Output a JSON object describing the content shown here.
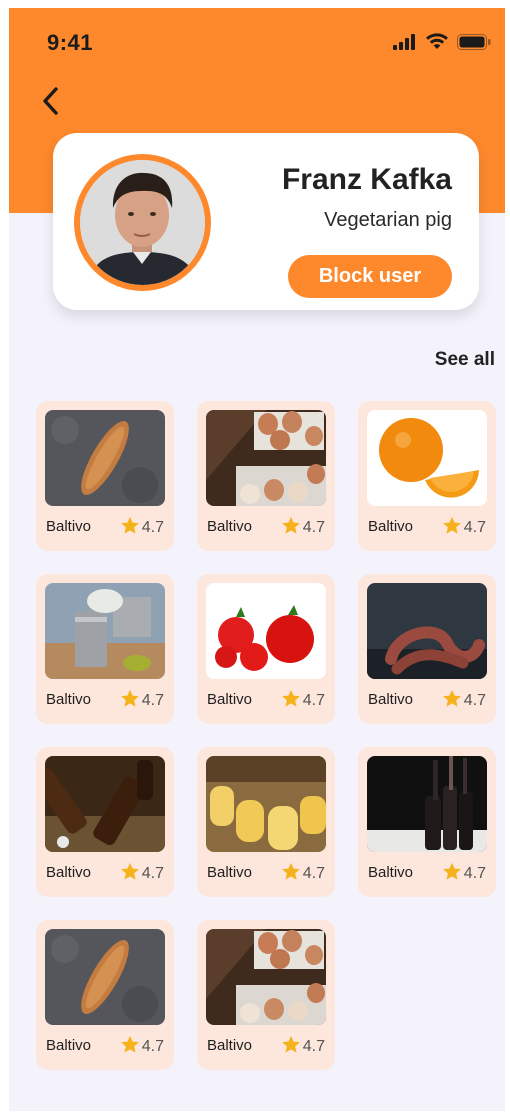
{
  "status_bar": {
    "time": "9:41",
    "icons": [
      "signal-icon",
      "wifi-icon",
      "battery-icon"
    ]
  },
  "colors": {
    "accent": "#fe892d",
    "card_bg": "#fde6dc",
    "page_bg": "#f4f3fb",
    "star": "#f6b21b"
  },
  "header": {
    "back_icon": "chevron-left-icon"
  },
  "profile": {
    "name": "Franz Kafka",
    "subtitle": "Vegetarian pig",
    "block_button_label": "Block user"
  },
  "products_section": {
    "see_all_label": "See all"
  },
  "products": [
    {
      "name": "Baltivo",
      "rating": "4.7",
      "image": "bread-loaf"
    },
    {
      "name": "Baltivo",
      "rating": "4.7",
      "image": "eggs"
    },
    {
      "name": "Baltivo",
      "rating": "4.7",
      "image": "orange"
    },
    {
      "name": "Baltivo",
      "rating": "4.7",
      "image": "canned-food"
    },
    {
      "name": "Baltivo",
      "rating": "4.7",
      "image": "tomatoes"
    },
    {
      "name": "Baltivo",
      "rating": "4.7",
      "image": "sausages"
    },
    {
      "name": "Baltivo",
      "rating": "4.7",
      "image": "beer-bottles"
    },
    {
      "name": "Baltivo",
      "rating": "4.7",
      "image": "cheese-wheels"
    },
    {
      "name": "Baltivo",
      "rating": "4.7",
      "image": "wine-bottles"
    },
    {
      "name": "Baltivo",
      "rating": "4.7",
      "image": "bread-loaf"
    },
    {
      "name": "Baltivo",
      "rating": "4.7",
      "image": "eggs"
    }
  ]
}
